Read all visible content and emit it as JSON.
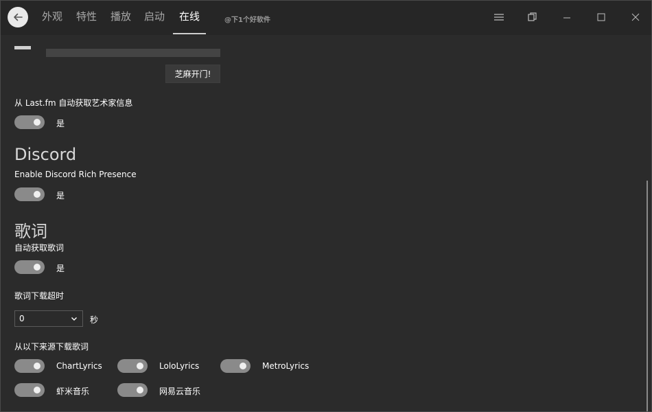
{
  "nav": {
    "tabs": [
      {
        "label": "外观"
      },
      {
        "label": "特性"
      },
      {
        "label": "播放"
      },
      {
        "label": "启动"
      },
      {
        "label": "在线"
      }
    ],
    "active_index": 4,
    "watermark": "@下1个好软件"
  },
  "window_controls": [
    "hamburger-icon",
    "restore-views-icon",
    "minimize-icon",
    "maximize-icon",
    "close-icon"
  ],
  "online": {
    "sesame_button": "芝麻开门!",
    "lastfm": {
      "label": "从 Last.fm 自动获取艺术家信息",
      "toggle_text": "是",
      "on": true
    }
  },
  "discord": {
    "title": "Discord",
    "rich_presence": {
      "label": "Enable Discord Rich Presence",
      "toggle_text": "是",
      "on": true
    }
  },
  "lyrics": {
    "title": "歌词",
    "auto_fetch": {
      "label": "自动获取歌词",
      "toggle_text": "是",
      "on": true
    },
    "timeout": {
      "label": "歌词下载超时",
      "value": "0",
      "unit": "秒"
    },
    "sources_label": "从以下来源下载歌词",
    "sources": [
      {
        "label": "ChartLyrics",
        "on": true
      },
      {
        "label": "LoloLyrics",
        "on": true
      },
      {
        "label": "MetroLyrics",
        "on": true
      },
      {
        "label": "虾米音乐",
        "on": true
      },
      {
        "label": "网易云音乐",
        "on": true
      }
    ]
  },
  "colors": {
    "background": "#2b2b2b",
    "titlebar": "#262626",
    "toggle_track": "#8a8a8a",
    "accent_text": "#ffffff"
  }
}
